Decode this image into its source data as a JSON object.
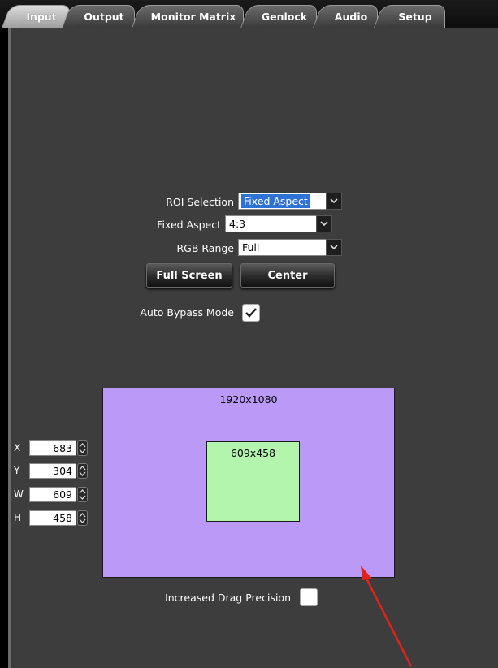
{
  "tabs": [
    "Input",
    "Output",
    "Monitor Matrix",
    "Genlock",
    "Audio",
    "Setup"
  ],
  "active_tab": "Input",
  "roi_selection": {
    "label": "ROI Selection",
    "value": "Fixed Aspect"
  },
  "fixed_aspect": {
    "label": "Fixed Aspect",
    "value": "4:3"
  },
  "rgb_range": {
    "label": "RGB Range",
    "value": "Full"
  },
  "buttons": {
    "full_screen": "Full Screen",
    "center": "Center"
  },
  "auto_bypass": {
    "label": "Auto Bypass Mode",
    "checked": true
  },
  "canvas": {
    "resolution": "1920x1080",
    "roi_size": "609x458",
    "color": "#bb9af7",
    "roi_color": "#b4f5ad"
  },
  "coords": [
    {
      "label": "X",
      "value": "683"
    },
    {
      "label": "Y",
      "value": "304"
    },
    {
      "label": "W",
      "value": "609"
    },
    {
      "label": "H",
      "value": "458"
    }
  ],
  "drag_precision": {
    "label": "Increased Drag Precision",
    "checked": false
  }
}
